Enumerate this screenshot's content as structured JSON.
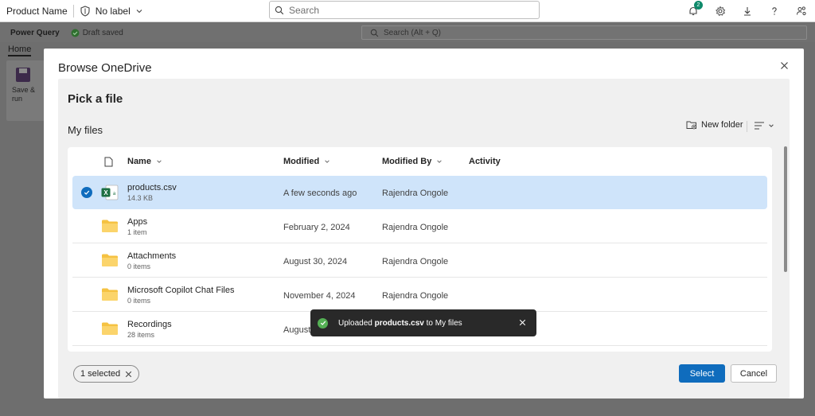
{
  "topbar": {
    "app_title": "Product Name",
    "sensitivity_label": "No label",
    "search_placeholder": "Search",
    "notification_count": "2"
  },
  "powerquery": {
    "name": "Power Query",
    "status": "Draft saved",
    "search_placeholder": "Search (Alt + Q)",
    "ribbon_tab": "Home",
    "save_label_line1": "Save &",
    "save_label_line2": "run"
  },
  "dialog": {
    "title": "Browse OneDrive",
    "picker_title": "Pick a file",
    "location": "My files",
    "new_folder_label": "New folder",
    "columns": {
      "name": "Name",
      "modified": "Modified",
      "modified_by": "Modified By",
      "activity": "Activity"
    },
    "rows": [
      {
        "name": "products.csv",
        "sub": "14.3 KB",
        "modified": "A few seconds ago",
        "modified_by": "Rajendra Ongole",
        "type": "excel-csv",
        "selected": true
      },
      {
        "name": "Apps",
        "sub": "1 item",
        "modified": "February 2, 2024",
        "modified_by": "Rajendra Ongole",
        "type": "folder",
        "selected": false
      },
      {
        "name": "Attachments",
        "sub": "0 items",
        "modified": "August 30, 2024",
        "modified_by": "Rajendra Ongole",
        "type": "folder",
        "selected": false
      },
      {
        "name": "Microsoft Copilot Chat Files",
        "sub": "0 items",
        "modified": "November 4, 2024",
        "modified_by": "Rajendra Ongole",
        "type": "folder",
        "selected": false
      },
      {
        "name": "Recordings",
        "sub": "28 items",
        "modified": "August",
        "modified_by": "",
        "type": "folder",
        "selected": false
      }
    ],
    "selected_count_label": "1 selected",
    "select_button": "Select",
    "cancel_button": "Cancel"
  },
  "toast": {
    "prefix": "Uploaded ",
    "filename": "products.csv",
    "suffix": " to My files"
  },
  "colors": {
    "accent": "#0f6cbd",
    "selected_row": "#cfe4fa",
    "folder": "#f5c242",
    "excel": "#1d6f42",
    "success": "#54b054"
  }
}
